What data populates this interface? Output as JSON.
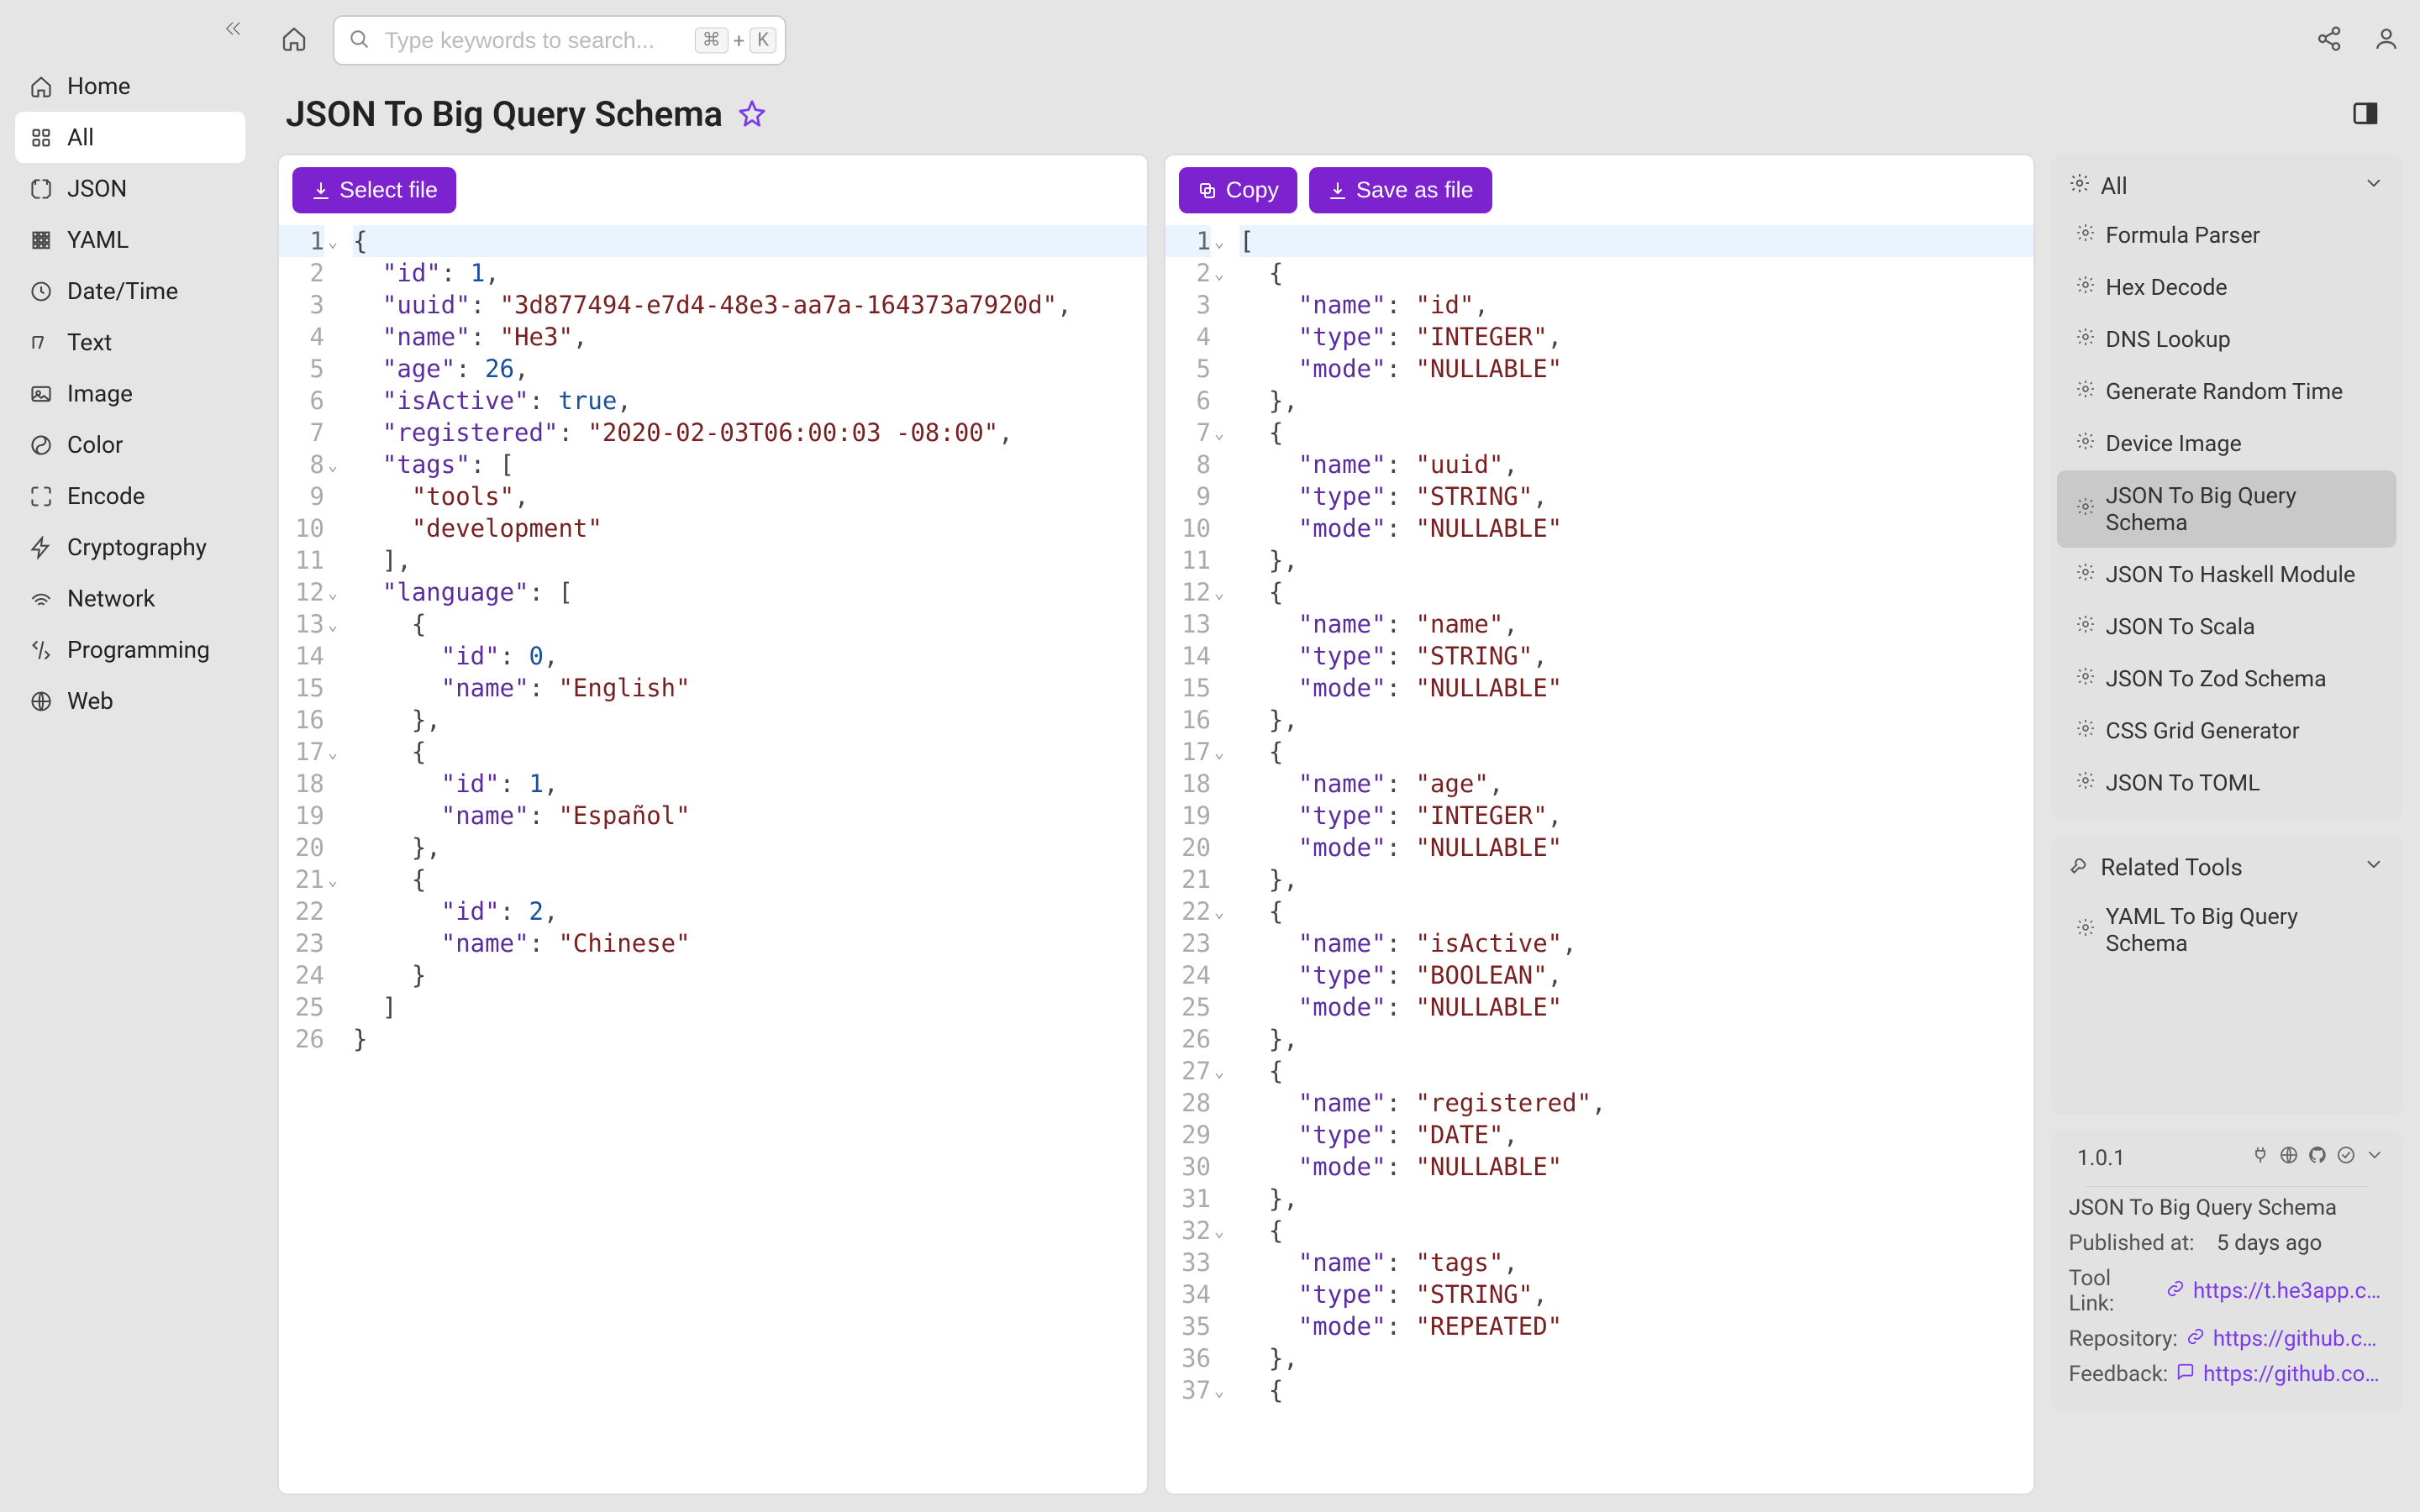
{
  "search": {
    "placeholder": "Type keywords to search...",
    "kbd1": "⌘",
    "plus": "+",
    "kbd2": "K"
  },
  "sidebar": {
    "items": [
      {
        "label": "Home"
      },
      {
        "label": "All"
      },
      {
        "label": "JSON"
      },
      {
        "label": "YAML"
      },
      {
        "label": "Date/Time"
      },
      {
        "label": "Text"
      },
      {
        "label": "Image"
      },
      {
        "label": "Color"
      },
      {
        "label": "Encode"
      },
      {
        "label": "Cryptography"
      },
      {
        "label": "Network"
      },
      {
        "label": "Programming"
      },
      {
        "label": "Web"
      }
    ]
  },
  "page": {
    "title": "JSON To Big Query Schema"
  },
  "actions": {
    "select_file": "Select file",
    "copy": "Copy",
    "save_as_file": "Save as file"
  },
  "left_code": [
    {
      "n": 1,
      "indent": 0,
      "fold": true,
      "active": true,
      "tokens": [
        {
          "t": "{",
          "c": "punc"
        }
      ]
    },
    {
      "n": 2,
      "indent": 1,
      "tokens": [
        {
          "t": "\"id\"",
          "c": "key"
        },
        {
          "t": ": ",
          "c": "punc"
        },
        {
          "t": "1",
          "c": "num"
        },
        {
          "t": ",",
          "c": "punc"
        }
      ]
    },
    {
      "n": 3,
      "indent": 1,
      "tokens": [
        {
          "t": "\"uuid\"",
          "c": "key"
        },
        {
          "t": ": ",
          "c": "punc"
        },
        {
          "t": "\"3d877494-e7d4-48e3-aa7a-164373a7920d\"",
          "c": "str"
        },
        {
          "t": ",",
          "c": "punc"
        }
      ]
    },
    {
      "n": 4,
      "indent": 1,
      "tokens": [
        {
          "t": "\"name\"",
          "c": "key"
        },
        {
          "t": ": ",
          "c": "punc"
        },
        {
          "t": "\"He3\"",
          "c": "str"
        },
        {
          "t": ",",
          "c": "punc"
        }
      ]
    },
    {
      "n": 5,
      "indent": 1,
      "tokens": [
        {
          "t": "\"age\"",
          "c": "key"
        },
        {
          "t": ": ",
          "c": "punc"
        },
        {
          "t": "26",
          "c": "num"
        },
        {
          "t": ",",
          "c": "punc"
        }
      ]
    },
    {
      "n": 6,
      "indent": 1,
      "tokens": [
        {
          "t": "\"isActive\"",
          "c": "key"
        },
        {
          "t": ": ",
          "c": "punc"
        },
        {
          "t": "true",
          "c": "bool"
        },
        {
          "t": ",",
          "c": "punc"
        }
      ]
    },
    {
      "n": 7,
      "indent": 1,
      "tokens": [
        {
          "t": "\"registered\"",
          "c": "key"
        },
        {
          "t": ": ",
          "c": "punc"
        },
        {
          "t": "\"2020-02-03T06:00:03 -08:00\"",
          "c": "str"
        },
        {
          "t": ",",
          "c": "punc"
        }
      ]
    },
    {
      "n": 8,
      "indent": 1,
      "fold": true,
      "tokens": [
        {
          "t": "\"tags\"",
          "c": "key"
        },
        {
          "t": ": [",
          "c": "punc"
        }
      ]
    },
    {
      "n": 9,
      "indent": 2,
      "tokens": [
        {
          "t": "\"tools\"",
          "c": "str"
        },
        {
          "t": ",",
          "c": "punc"
        }
      ]
    },
    {
      "n": 10,
      "indent": 2,
      "tokens": [
        {
          "t": "\"development\"",
          "c": "str"
        }
      ]
    },
    {
      "n": 11,
      "indent": 1,
      "tokens": [
        {
          "t": "],",
          "c": "punc"
        }
      ]
    },
    {
      "n": 12,
      "indent": 1,
      "fold": true,
      "tokens": [
        {
          "t": "\"language\"",
          "c": "key"
        },
        {
          "t": ": [",
          "c": "punc"
        }
      ]
    },
    {
      "n": 13,
      "indent": 2,
      "fold": true,
      "tokens": [
        {
          "t": "{",
          "c": "punc"
        }
      ]
    },
    {
      "n": 14,
      "indent": 3,
      "tokens": [
        {
          "t": "\"id\"",
          "c": "key"
        },
        {
          "t": ": ",
          "c": "punc"
        },
        {
          "t": "0",
          "c": "num"
        },
        {
          "t": ",",
          "c": "punc"
        }
      ]
    },
    {
      "n": 15,
      "indent": 3,
      "tokens": [
        {
          "t": "\"name\"",
          "c": "key"
        },
        {
          "t": ": ",
          "c": "punc"
        },
        {
          "t": "\"English\"",
          "c": "str"
        }
      ]
    },
    {
      "n": 16,
      "indent": 2,
      "tokens": [
        {
          "t": "},",
          "c": "punc"
        }
      ]
    },
    {
      "n": 17,
      "indent": 2,
      "fold": true,
      "tokens": [
        {
          "t": "{",
          "c": "punc"
        }
      ]
    },
    {
      "n": 18,
      "indent": 3,
      "tokens": [
        {
          "t": "\"id\"",
          "c": "key"
        },
        {
          "t": ": ",
          "c": "punc"
        },
        {
          "t": "1",
          "c": "num"
        },
        {
          "t": ",",
          "c": "punc"
        }
      ]
    },
    {
      "n": 19,
      "indent": 3,
      "tokens": [
        {
          "t": "\"name\"",
          "c": "key"
        },
        {
          "t": ": ",
          "c": "punc"
        },
        {
          "t": "\"Español\"",
          "c": "str"
        }
      ]
    },
    {
      "n": 20,
      "indent": 2,
      "tokens": [
        {
          "t": "},",
          "c": "punc"
        }
      ]
    },
    {
      "n": 21,
      "indent": 2,
      "fold": true,
      "tokens": [
        {
          "t": "{",
          "c": "punc"
        }
      ]
    },
    {
      "n": 22,
      "indent": 3,
      "tokens": [
        {
          "t": "\"id\"",
          "c": "key"
        },
        {
          "t": ": ",
          "c": "punc"
        },
        {
          "t": "2",
          "c": "num"
        },
        {
          "t": ",",
          "c": "punc"
        }
      ]
    },
    {
      "n": 23,
      "indent": 3,
      "tokens": [
        {
          "t": "\"name\"",
          "c": "key"
        },
        {
          "t": ": ",
          "c": "punc"
        },
        {
          "t": "\"Chinese\"",
          "c": "str"
        }
      ]
    },
    {
      "n": 24,
      "indent": 2,
      "tokens": [
        {
          "t": "}",
          "c": "punc"
        }
      ]
    },
    {
      "n": 25,
      "indent": 1,
      "tokens": [
        {
          "t": "]",
          "c": "punc"
        }
      ]
    },
    {
      "n": 26,
      "indent": 0,
      "tokens": [
        {
          "t": "}",
          "c": "punc"
        }
      ]
    }
  ],
  "right_code": [
    {
      "n": 1,
      "indent": 0,
      "fold": true,
      "active": true,
      "tokens": [
        {
          "t": "[",
          "c": "punc"
        }
      ]
    },
    {
      "n": 2,
      "indent": 1,
      "fold": true,
      "tokens": [
        {
          "t": "{",
          "c": "punc"
        }
      ]
    },
    {
      "n": 3,
      "indent": 2,
      "tokens": [
        {
          "t": "\"name\"",
          "c": "key"
        },
        {
          "t": ": ",
          "c": "punc"
        },
        {
          "t": "\"id\"",
          "c": "str"
        },
        {
          "t": ",",
          "c": "punc"
        }
      ]
    },
    {
      "n": 4,
      "indent": 2,
      "tokens": [
        {
          "t": "\"type\"",
          "c": "key"
        },
        {
          "t": ": ",
          "c": "punc"
        },
        {
          "t": "\"INTEGER\"",
          "c": "str"
        },
        {
          "t": ",",
          "c": "punc"
        }
      ]
    },
    {
      "n": 5,
      "indent": 2,
      "tokens": [
        {
          "t": "\"mode\"",
          "c": "key"
        },
        {
          "t": ": ",
          "c": "punc"
        },
        {
          "t": "\"NULLABLE\"",
          "c": "str"
        }
      ]
    },
    {
      "n": 6,
      "indent": 1,
      "tokens": [
        {
          "t": "},",
          "c": "punc"
        }
      ]
    },
    {
      "n": 7,
      "indent": 1,
      "fold": true,
      "tokens": [
        {
          "t": "{",
          "c": "punc"
        }
      ]
    },
    {
      "n": 8,
      "indent": 2,
      "tokens": [
        {
          "t": "\"name\"",
          "c": "key"
        },
        {
          "t": ": ",
          "c": "punc"
        },
        {
          "t": "\"uuid\"",
          "c": "str"
        },
        {
          "t": ",",
          "c": "punc"
        }
      ]
    },
    {
      "n": 9,
      "indent": 2,
      "tokens": [
        {
          "t": "\"type\"",
          "c": "key"
        },
        {
          "t": ": ",
          "c": "punc"
        },
        {
          "t": "\"STRING\"",
          "c": "str"
        },
        {
          "t": ",",
          "c": "punc"
        }
      ]
    },
    {
      "n": 10,
      "indent": 2,
      "tokens": [
        {
          "t": "\"mode\"",
          "c": "key"
        },
        {
          "t": ": ",
          "c": "punc"
        },
        {
          "t": "\"NULLABLE\"",
          "c": "str"
        }
      ]
    },
    {
      "n": 11,
      "indent": 1,
      "tokens": [
        {
          "t": "},",
          "c": "punc"
        }
      ]
    },
    {
      "n": 12,
      "indent": 1,
      "fold": true,
      "tokens": [
        {
          "t": "{",
          "c": "punc"
        }
      ]
    },
    {
      "n": 13,
      "indent": 2,
      "tokens": [
        {
          "t": "\"name\"",
          "c": "key"
        },
        {
          "t": ": ",
          "c": "punc"
        },
        {
          "t": "\"name\"",
          "c": "str"
        },
        {
          "t": ",",
          "c": "punc"
        }
      ]
    },
    {
      "n": 14,
      "indent": 2,
      "tokens": [
        {
          "t": "\"type\"",
          "c": "key"
        },
        {
          "t": ": ",
          "c": "punc"
        },
        {
          "t": "\"STRING\"",
          "c": "str"
        },
        {
          "t": ",",
          "c": "punc"
        }
      ]
    },
    {
      "n": 15,
      "indent": 2,
      "tokens": [
        {
          "t": "\"mode\"",
          "c": "key"
        },
        {
          "t": ": ",
          "c": "punc"
        },
        {
          "t": "\"NULLABLE\"",
          "c": "str"
        }
      ]
    },
    {
      "n": 16,
      "indent": 1,
      "tokens": [
        {
          "t": "},",
          "c": "punc"
        }
      ]
    },
    {
      "n": 17,
      "indent": 1,
      "fold": true,
      "tokens": [
        {
          "t": "{",
          "c": "punc"
        }
      ]
    },
    {
      "n": 18,
      "indent": 2,
      "tokens": [
        {
          "t": "\"name\"",
          "c": "key"
        },
        {
          "t": ": ",
          "c": "punc"
        },
        {
          "t": "\"age\"",
          "c": "str"
        },
        {
          "t": ",",
          "c": "punc"
        }
      ]
    },
    {
      "n": 19,
      "indent": 2,
      "tokens": [
        {
          "t": "\"type\"",
          "c": "key"
        },
        {
          "t": ": ",
          "c": "punc"
        },
        {
          "t": "\"INTEGER\"",
          "c": "str"
        },
        {
          "t": ",",
          "c": "punc"
        }
      ]
    },
    {
      "n": 20,
      "indent": 2,
      "tokens": [
        {
          "t": "\"mode\"",
          "c": "key"
        },
        {
          "t": ": ",
          "c": "punc"
        },
        {
          "t": "\"NULLABLE\"",
          "c": "str"
        }
      ]
    },
    {
      "n": 21,
      "indent": 1,
      "tokens": [
        {
          "t": "},",
          "c": "punc"
        }
      ]
    },
    {
      "n": 22,
      "indent": 1,
      "fold": true,
      "tokens": [
        {
          "t": "{",
          "c": "punc"
        }
      ]
    },
    {
      "n": 23,
      "indent": 2,
      "tokens": [
        {
          "t": "\"name\"",
          "c": "key"
        },
        {
          "t": ": ",
          "c": "punc"
        },
        {
          "t": "\"isActive\"",
          "c": "str"
        },
        {
          "t": ",",
          "c": "punc"
        }
      ]
    },
    {
      "n": 24,
      "indent": 2,
      "tokens": [
        {
          "t": "\"type\"",
          "c": "key"
        },
        {
          "t": ": ",
          "c": "punc"
        },
        {
          "t": "\"BOOLEAN\"",
          "c": "str"
        },
        {
          "t": ",",
          "c": "punc"
        }
      ]
    },
    {
      "n": 25,
      "indent": 2,
      "tokens": [
        {
          "t": "\"mode\"",
          "c": "key"
        },
        {
          "t": ": ",
          "c": "punc"
        },
        {
          "t": "\"NULLABLE\"",
          "c": "str"
        }
      ]
    },
    {
      "n": 26,
      "indent": 1,
      "tokens": [
        {
          "t": "},",
          "c": "punc"
        }
      ]
    },
    {
      "n": 27,
      "indent": 1,
      "fold": true,
      "tokens": [
        {
          "t": "{",
          "c": "punc"
        }
      ]
    },
    {
      "n": 28,
      "indent": 2,
      "tokens": [
        {
          "t": "\"name\"",
          "c": "key"
        },
        {
          "t": ": ",
          "c": "punc"
        },
        {
          "t": "\"registered\"",
          "c": "str"
        },
        {
          "t": ",",
          "c": "punc"
        }
      ]
    },
    {
      "n": 29,
      "indent": 2,
      "tokens": [
        {
          "t": "\"type\"",
          "c": "key"
        },
        {
          "t": ": ",
          "c": "punc"
        },
        {
          "t": "\"DATE\"",
          "c": "str"
        },
        {
          "t": ",",
          "c": "punc"
        }
      ]
    },
    {
      "n": 30,
      "indent": 2,
      "tokens": [
        {
          "t": "\"mode\"",
          "c": "key"
        },
        {
          "t": ": ",
          "c": "punc"
        },
        {
          "t": "\"NULLABLE\"",
          "c": "str"
        }
      ]
    },
    {
      "n": 31,
      "indent": 1,
      "tokens": [
        {
          "t": "},",
          "c": "punc"
        }
      ]
    },
    {
      "n": 32,
      "indent": 1,
      "fold": true,
      "tokens": [
        {
          "t": "{",
          "c": "punc"
        }
      ]
    },
    {
      "n": 33,
      "indent": 2,
      "tokens": [
        {
          "t": "\"name\"",
          "c": "key"
        },
        {
          "t": ": ",
          "c": "punc"
        },
        {
          "t": "\"tags\"",
          "c": "str"
        },
        {
          "t": ",",
          "c": "punc"
        }
      ]
    },
    {
      "n": 34,
      "indent": 2,
      "tokens": [
        {
          "t": "\"type\"",
          "c": "key"
        },
        {
          "t": ": ",
          "c": "punc"
        },
        {
          "t": "\"STRING\"",
          "c": "str"
        },
        {
          "t": ",",
          "c": "punc"
        }
      ]
    },
    {
      "n": 35,
      "indent": 2,
      "tokens": [
        {
          "t": "\"mode\"",
          "c": "key"
        },
        {
          "t": ": ",
          "c": "punc"
        },
        {
          "t": "\"REPEATED\"",
          "c": "str"
        }
      ]
    },
    {
      "n": 36,
      "indent": 1,
      "tokens": [
        {
          "t": "},",
          "c": "punc"
        }
      ]
    },
    {
      "n": 37,
      "indent": 1,
      "fold": true,
      "tokens": [
        {
          "t": "{",
          "c": "punc"
        }
      ]
    }
  ],
  "right_panel": {
    "filter_head": "All",
    "tools": [
      "Formula Parser",
      "Hex Decode",
      "DNS Lookup",
      "Generate Random Time",
      "Device Image",
      "JSON To Big Query Schema",
      "JSON To Haskell Module",
      "JSON To Scala",
      "JSON To Zod Schema",
      "CSS Grid Generator",
      "JSON To TOML"
    ],
    "active_tool_index": 5,
    "related_head": "Related Tools",
    "related": [
      "YAML To Big Query Schema"
    ]
  },
  "info": {
    "version": "1.0.1",
    "title": "JSON To Big Query Schema",
    "published_label": "Published at:",
    "published_value": "5 days ago",
    "tool_link_label": "Tool Link:",
    "tool_link": "https://t.he3app.co…",
    "repo_label": "Repository:",
    "repo_link": "https://github.com…",
    "feedback_label": "Feedback:",
    "feedback_link": "https://github.com/…"
  }
}
